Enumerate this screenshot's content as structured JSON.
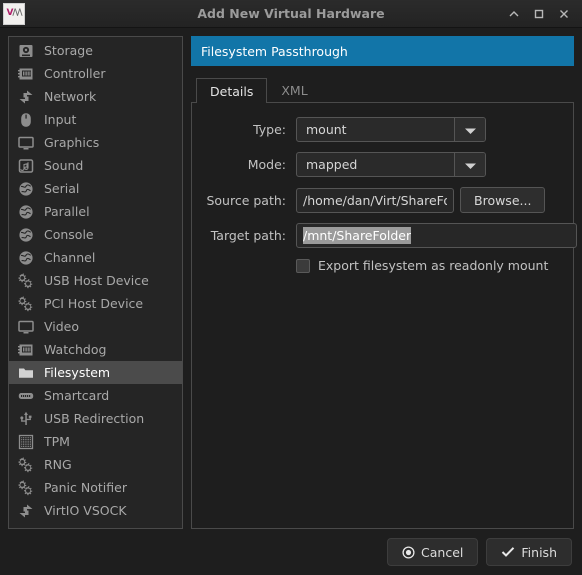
{
  "window": {
    "title": "Add New Virtual Hardware",
    "app_icon": "virt-manager-logo-icon",
    "logo_v": "V",
    "logo_m": "/\\/\\",
    "controls": [
      {
        "name": "minimize-button",
        "icon": "chevron-up-icon"
      },
      {
        "name": "maximize-button",
        "icon": "square-icon"
      },
      {
        "name": "close-button",
        "icon": "close-icon"
      }
    ]
  },
  "sidebar": {
    "items": [
      {
        "label": "Storage",
        "icon": "storage-disk-icon",
        "selected": false
      },
      {
        "label": "Controller",
        "icon": "controller-card-icon",
        "selected": false
      },
      {
        "label": "Network",
        "icon": "network-arrows-icon",
        "selected": false
      },
      {
        "label": "Input",
        "icon": "mouse-icon",
        "selected": false
      },
      {
        "label": "Graphics",
        "icon": "monitor-icon",
        "selected": false
      },
      {
        "label": "Sound",
        "icon": "sound-note-icon",
        "selected": false
      },
      {
        "label": "Serial",
        "icon": "globe-icon",
        "selected": false
      },
      {
        "label": "Parallel",
        "icon": "globe-icon",
        "selected": false
      },
      {
        "label": "Console",
        "icon": "globe-icon",
        "selected": false
      },
      {
        "label": "Channel",
        "icon": "globe-icon",
        "selected": false
      },
      {
        "label": "USB Host Device",
        "icon": "gears-icon",
        "selected": false
      },
      {
        "label": "PCI Host Device",
        "icon": "gears-icon",
        "selected": false
      },
      {
        "label": "Video",
        "icon": "monitor-icon",
        "selected": false
      },
      {
        "label": "Watchdog",
        "icon": "controller-card-icon",
        "selected": false
      },
      {
        "label": "Filesystem",
        "icon": "folder-icon",
        "selected": true
      },
      {
        "label": "Smartcard",
        "icon": "smartcard-icon",
        "selected": false
      },
      {
        "label": "USB Redirection",
        "icon": "usb-icon",
        "selected": false
      },
      {
        "label": "TPM",
        "icon": "chip-icon",
        "selected": false
      },
      {
        "label": "RNG",
        "icon": "gears-icon",
        "selected": false
      },
      {
        "label": "Panic Notifier",
        "icon": "gears-icon",
        "selected": false
      },
      {
        "label": "VirtIO VSOCK",
        "icon": "network-arrows-icon",
        "selected": false
      }
    ]
  },
  "main": {
    "banner_title": "Filesystem Passthrough",
    "banner_color": "#1275a8",
    "tabs": [
      {
        "label": "Details",
        "active": true
      },
      {
        "label": "XML",
        "active": false
      }
    ],
    "form": {
      "type": {
        "label": "Type:",
        "value": "mount"
      },
      "mode": {
        "label": "Mode:",
        "value": "mapped"
      },
      "source_path": {
        "label": "Source path:",
        "value": "/home/dan/Virt/ShareFolder",
        "browse_label": "Browse..."
      },
      "target_path": {
        "label": "Target path:",
        "value": "/mnt/ShareFolder",
        "selected": true
      },
      "readonly_checkbox": {
        "label": "Export filesystem as readonly mount",
        "checked": false
      }
    }
  },
  "footer": {
    "cancel_label": "Cancel",
    "finish_label": "Finish",
    "cancel_icon": "cancel-circle-icon",
    "finish_icon": "check-icon"
  }
}
